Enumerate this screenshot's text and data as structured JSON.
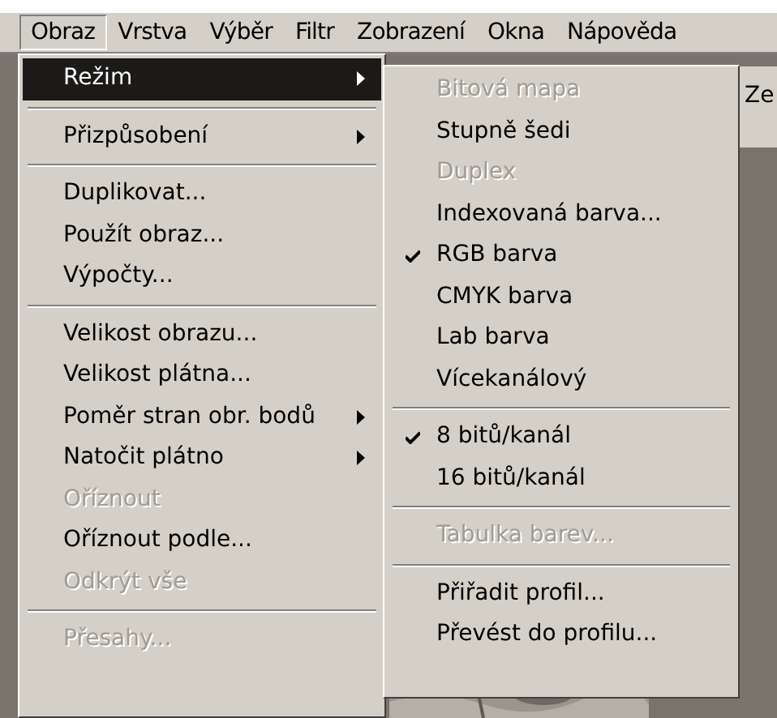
{
  "menu_bar": [
    {
      "label": "Obraz",
      "selected": true
    },
    {
      "label": "Vrstva",
      "selected": false
    },
    {
      "label": "Výběr",
      "selected": false
    },
    {
      "label": "Filtr",
      "selected": false
    },
    {
      "label": "Zobrazení",
      "selected": false
    },
    {
      "label": "Okna",
      "selected": false
    },
    {
      "label": "Nápověda",
      "selected": false
    }
  ],
  "toolbar": {
    "label": "Ze"
  },
  "image_menu": [
    {
      "kind": "item",
      "label": "Režim",
      "selected": true,
      "disabled": false,
      "submenu": true
    },
    {
      "kind": "separator"
    },
    {
      "kind": "item",
      "label": "Přizpůsobení",
      "selected": false,
      "disabled": false,
      "submenu": true
    },
    {
      "kind": "separator"
    },
    {
      "kind": "item",
      "label": "Duplikovat...",
      "selected": false,
      "disabled": false,
      "submenu": false
    },
    {
      "kind": "item",
      "label": "Použít obraz...",
      "selected": false,
      "disabled": false,
      "submenu": false
    },
    {
      "kind": "item",
      "label": "Výpočty...",
      "selected": false,
      "disabled": false,
      "submenu": false
    },
    {
      "kind": "separator"
    },
    {
      "kind": "item",
      "label": "Velikost obrazu...",
      "selected": false,
      "disabled": false,
      "submenu": false
    },
    {
      "kind": "item",
      "label": "Velikost plátna...",
      "selected": false,
      "disabled": false,
      "submenu": false
    },
    {
      "kind": "item",
      "label": "Poměr stran obr. bodů",
      "selected": false,
      "disabled": false,
      "submenu": true
    },
    {
      "kind": "item",
      "label": "Natočit plátno",
      "selected": false,
      "disabled": false,
      "submenu": true
    },
    {
      "kind": "item",
      "label": "Oříznout",
      "selected": false,
      "disabled": true,
      "submenu": false
    },
    {
      "kind": "item",
      "label": "Oříznout podle...",
      "selected": false,
      "disabled": false,
      "submenu": false
    },
    {
      "kind": "item",
      "label": "Odkrýt vše",
      "selected": false,
      "disabled": true,
      "submenu": false
    },
    {
      "kind": "separator"
    },
    {
      "kind": "item",
      "label": "Přesahy...",
      "selected": false,
      "disabled": true,
      "submenu": false
    }
  ],
  "mode_submenu": [
    {
      "kind": "item",
      "label": "Bitová mapa",
      "checked": false,
      "disabled": true
    },
    {
      "kind": "item",
      "label": "Stupně šedi",
      "checked": false,
      "disabled": false
    },
    {
      "kind": "item",
      "label": "Duplex",
      "checked": false,
      "disabled": true
    },
    {
      "kind": "item",
      "label": "Indexovaná barva...",
      "checked": false,
      "disabled": false
    },
    {
      "kind": "item",
      "label": "RGB barva",
      "checked": true,
      "disabled": false
    },
    {
      "kind": "item",
      "label": "CMYK barva",
      "checked": false,
      "disabled": false
    },
    {
      "kind": "item",
      "label": "Lab barva",
      "checked": false,
      "disabled": false
    },
    {
      "kind": "item",
      "label": "Vícekanálový",
      "checked": false,
      "disabled": false
    },
    {
      "kind": "separator"
    },
    {
      "kind": "item",
      "label": "8 bitů/kanál",
      "checked": true,
      "disabled": false
    },
    {
      "kind": "item",
      "label": "16 bitů/kanál",
      "checked": false,
      "disabled": false
    },
    {
      "kind": "separator"
    },
    {
      "kind": "item",
      "label": "Tabulka barev...",
      "checked": false,
      "disabled": true
    },
    {
      "kind": "separator"
    },
    {
      "kind": "item",
      "label": "Přiřadit profil...",
      "checked": false,
      "disabled": false
    },
    {
      "kind": "item",
      "label": "Převést do profilu...",
      "checked": false,
      "disabled": false
    }
  ]
}
